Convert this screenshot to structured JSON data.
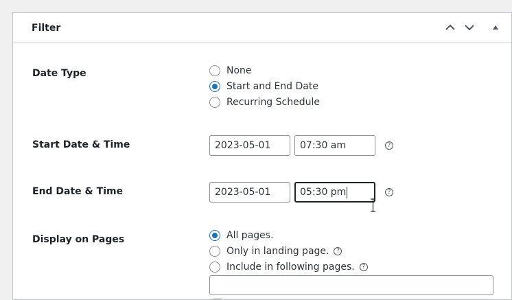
{
  "panel": {
    "title": "Filter",
    "controls": {
      "up_icon": "chevron-up-icon",
      "down_icon": "chevron-down-icon",
      "toggle_icon": "triangle-up-icon"
    }
  },
  "date_type": {
    "label": "Date Type",
    "options": [
      {
        "label": "None",
        "checked": false
      },
      {
        "label": "Start and End Date",
        "checked": true
      },
      {
        "label": "Recurring Schedule",
        "checked": false
      }
    ]
  },
  "start": {
    "label": "Start Date & Time",
    "date": "2023-05-01",
    "time": "07:30 am"
  },
  "end": {
    "label": "End Date & Time",
    "date": "2023-05-01",
    "time": "05:30 pm"
  },
  "display_pages": {
    "label": "Display on Pages",
    "options": [
      {
        "label": "All pages.",
        "checked": true,
        "help": false
      },
      {
        "label": "Only in landing page.",
        "checked": false,
        "help": true
      },
      {
        "label": "Include in following pages.",
        "checked": false,
        "help": true
      }
    ],
    "pages_input_value": ""
  },
  "colors": {
    "accent": "#2271b1",
    "border": "#c3c4c7",
    "background": "#f0f0f1"
  }
}
